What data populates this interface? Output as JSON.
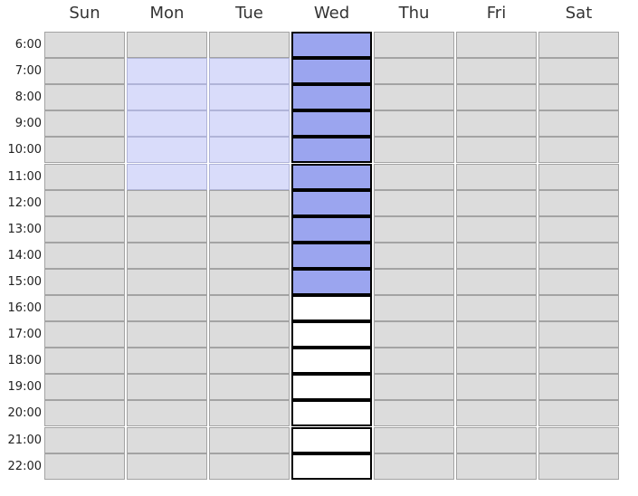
{
  "days": [
    "Sun",
    "Mon",
    "Tue",
    "Wed",
    "Thu",
    "Fri",
    "Sat"
  ],
  "hours": [
    "6:00",
    "7:00",
    "8:00",
    "9:00",
    "10:00",
    "11:00",
    "12:00",
    "13:00",
    "14:00",
    "15:00",
    "16:00",
    "17:00",
    "18:00",
    "19:00",
    "20:00",
    "21:00",
    "22:00"
  ],
  "selected_day": "Wed",
  "cell_states": [
    [
      "unavailable",
      "unavailable",
      "unavailable",
      "selected",
      "unavailable",
      "unavailable",
      "unavailable"
    ],
    [
      "unavailable",
      "available",
      "available",
      "selected",
      "unavailable",
      "unavailable",
      "unavailable"
    ],
    [
      "unavailable",
      "available",
      "available",
      "selected",
      "unavailable",
      "unavailable",
      "unavailable"
    ],
    [
      "unavailable",
      "available",
      "available",
      "selected",
      "unavailable",
      "unavailable",
      "unavailable"
    ],
    [
      "unavailable",
      "available",
      "available",
      "selected",
      "unavailable",
      "unavailable",
      "unavailable"
    ],
    [
      "unavailable",
      "available",
      "available",
      "selected",
      "unavailable",
      "unavailable",
      "unavailable"
    ],
    [
      "unavailable",
      "unavailable",
      "unavailable",
      "selected",
      "unavailable",
      "unavailable",
      "unavailable"
    ],
    [
      "unavailable",
      "unavailable",
      "unavailable",
      "selected",
      "unavailable",
      "unavailable",
      "unavailable"
    ],
    [
      "unavailable",
      "unavailable",
      "unavailable",
      "selected",
      "unavailable",
      "unavailable",
      "unavailable"
    ],
    [
      "unavailable",
      "unavailable",
      "unavailable",
      "selected",
      "unavailable",
      "unavailable",
      "unavailable"
    ],
    [
      "unavailable",
      "unavailable",
      "unavailable",
      "open",
      "unavailable",
      "unavailable",
      "unavailable"
    ],
    [
      "unavailable",
      "unavailable",
      "unavailable",
      "open",
      "unavailable",
      "unavailable",
      "unavailable"
    ],
    [
      "unavailable",
      "unavailable",
      "unavailable",
      "open",
      "unavailable",
      "unavailable",
      "unavailable"
    ],
    [
      "unavailable",
      "unavailable",
      "unavailable",
      "open",
      "unavailable",
      "unavailable",
      "unavailable"
    ],
    [
      "unavailable",
      "unavailable",
      "unavailable",
      "open",
      "unavailable",
      "unavailable",
      "unavailable"
    ],
    [
      "unavailable",
      "unavailable",
      "unavailable",
      "open",
      "unavailable",
      "unavailable",
      "unavailable"
    ],
    [
      "unavailable",
      "unavailable",
      "unavailable",
      "open",
      "unavailable",
      "unavailable",
      "unavailable"
    ]
  ],
  "colors": {
    "unavailable": "#dcdcdc",
    "available": "#d9dcfa",
    "selected": "#9ba5ef",
    "open": "#ffffff",
    "selected_border": "#000000"
  }
}
